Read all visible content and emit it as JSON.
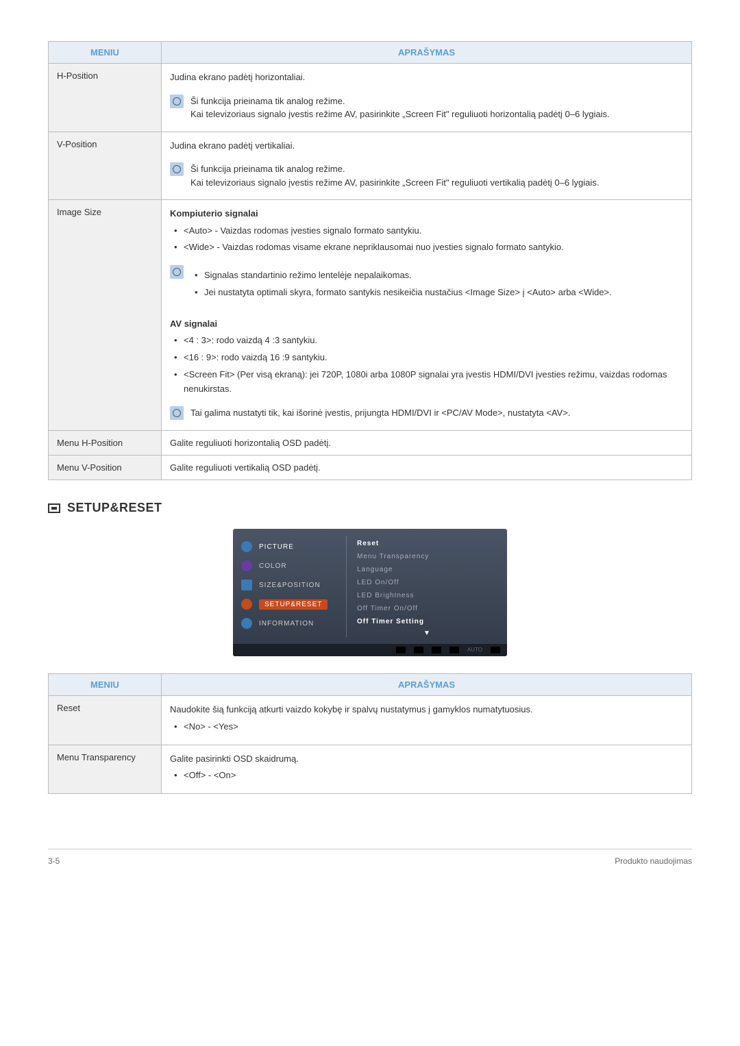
{
  "tables": {
    "t1": {
      "header_menu": "MENIU",
      "header_desc": "APRAŠYMAS",
      "rows": [
        {
          "menu": "H-Position",
          "desc": "Judina ekrano padėtį horizontaliai.",
          "note1": "Ši funkcija prieinama tik analog režime.",
          "note2": "Kai televizoriaus signalo įvestis režime AV, pasirinkite „Screen Fit\" reguliuoti horizontalią padėtį 0–6 lygiais."
        },
        {
          "menu": "V-Position",
          "desc": "Judina ekrano padėtį vertikaliai.",
          "note1": "Ši funkcija prieinama tik analog režime.",
          "note2": "Kai televizoriaus signalo įvestis režime AV, pasirinkite „Screen Fit\" reguliuoti vertikalią padėtį 0–6 lygiais."
        },
        {
          "menu": "Image Size",
          "heading1": "Kompiuterio signalai",
          "b1": "<Auto> - Vaizdas rodomas įvesties signalo formato santykiu.",
          "b2": "<Wide> - Vaizdas rodomas visame ekrane nepriklausomai nuo įvesties signalo formato santykio.",
          "nb1": "Signalas standartinio režimo lentelėje nepalaikomas.",
          "nb2": "Jei nustatyta optimali skyra, formato santykis nesikeičia nustačius <Image Size> į <Auto> arba <Wide>.",
          "heading2": "AV signalai",
          "c1": "<4 : 3>: rodo vaizdą 4 :3 santykiu.",
          "c2": "<16 : 9>: rodo vaizdą 16 :9 santykiu.",
          "c3": "<Screen Fit> (Per visą ekraną): jei 720P, 1080i arba 1080P signalai yra įvestis HDMI/DVI įvesties režimu, vaizdas rodomas nenukirstas.",
          "note3": "Tai galima nustatyti tik, kai išorinė įvestis, prijungta HDMI/DVI ir <PC/AV Mode>, nustatyta <AV>."
        },
        {
          "menu": "Menu H-Position",
          "desc": "Galite reguliuoti horizontalią OSD padėtį."
        },
        {
          "menu": "Menu V-Position",
          "desc": "Galite reguliuoti vertikalią OSD padėtį."
        }
      ]
    },
    "t2": {
      "header_menu": "MENIU",
      "header_desc": "APRAŠYMAS",
      "rows": [
        {
          "menu": "Reset",
          "desc": "Naudokite šią funkciją atkurti vaizdo kokybę ir spalvų nustatymus į gamyklos numatytuosius.",
          "opt": "<No> - <Yes>"
        },
        {
          "menu": "Menu Transparency",
          "desc": "Galite pasirinkti OSD skaidrumą.",
          "opt": "<Off> - <On>"
        }
      ]
    }
  },
  "section_title": "SETUP&RESET",
  "osd": {
    "left": [
      "PICTURE",
      "COLOR",
      "SIZE&POSITION",
      "SETUP&RESET",
      "INFORMATION"
    ],
    "right": [
      "Reset",
      "Menu Transparency",
      "Language",
      "LED On/Off",
      "LED Brightness",
      "Off Timer On/Off",
      "Off Timer Setting"
    ],
    "footer_auto": "AUTO"
  },
  "footer": {
    "left": "3-5",
    "right": "Produkto naudojimas"
  }
}
